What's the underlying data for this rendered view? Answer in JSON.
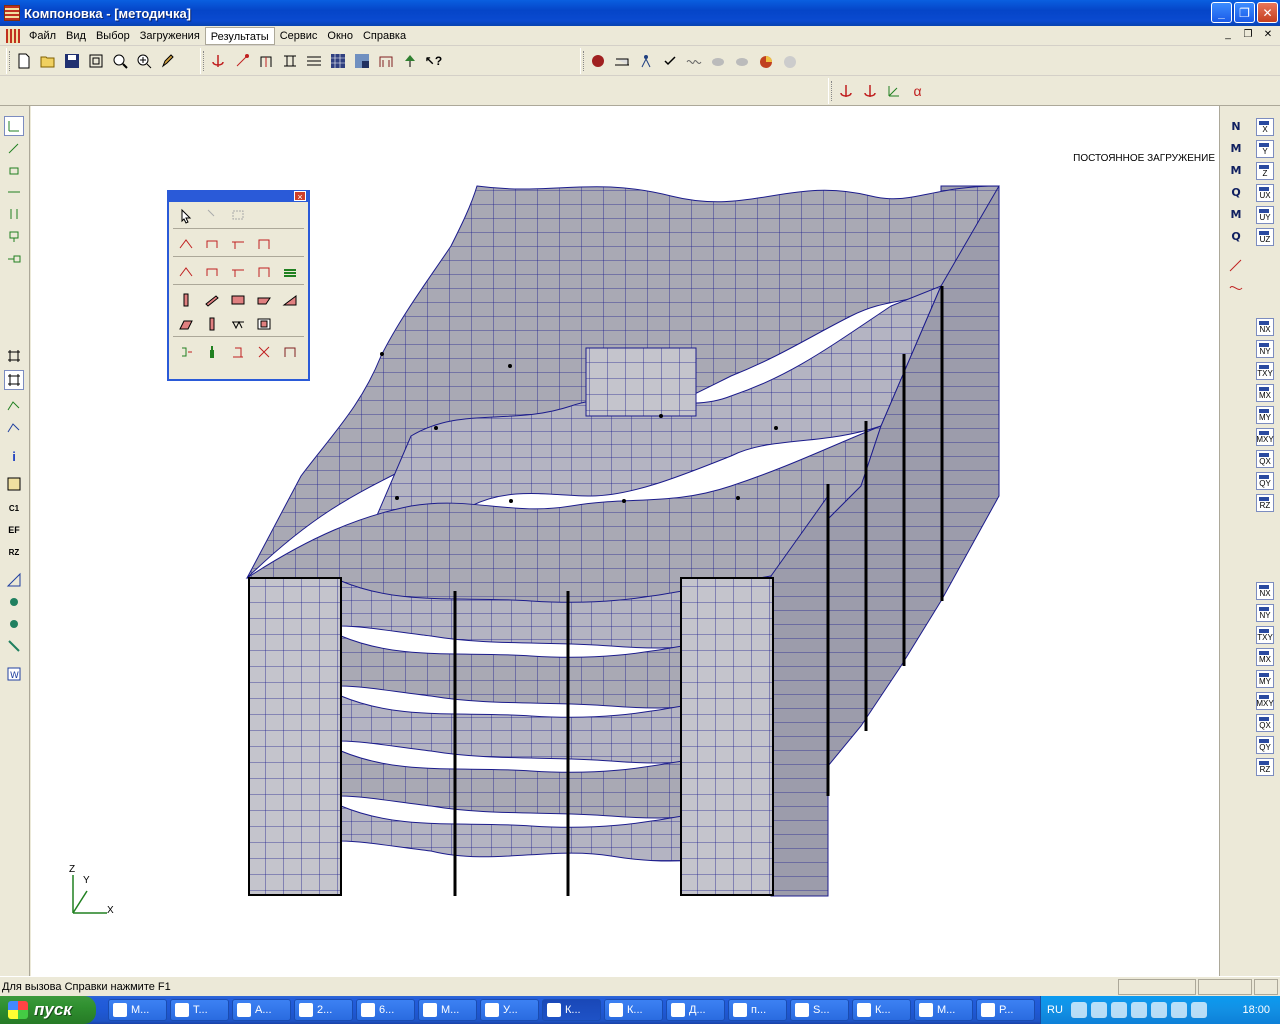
{
  "window": {
    "title": "Компоновка - [методичка]"
  },
  "menu": {
    "items": [
      "Файл",
      "Вид",
      "Выбор",
      "Загружения",
      "Результаты",
      "Сервис",
      "Окно",
      "Справка"
    ],
    "active_index": 4
  },
  "canvas": {
    "load_case": "ПОСТОЯННОЕ ЗАГРУЖЕНИЕ",
    "axis_z": "Z",
    "axis_y": "Y",
    "axis_x": "X"
  },
  "right_toolbar": {
    "col1": [
      "N",
      "M",
      "M",
      "Q",
      "M",
      "Q"
    ],
    "col2_top": [
      "X",
      "Y",
      "Z",
      "UX",
      "UY",
      "UZ"
    ],
    "col2_mid": [
      "NX",
      "NY",
      "TXY",
      "MX",
      "MY",
      "MXY",
      "QX",
      "QY",
      "RZ"
    ],
    "col2_bot": [
      "NX",
      "NY",
      "TXY",
      "MX",
      "MY",
      "MXY",
      "QX",
      "QY",
      "RZ"
    ]
  },
  "left_toolbar": {
    "labels": [
      "i",
      "C1",
      "EF",
      "RZ"
    ]
  },
  "toolbar2": {
    "alpha": "α"
  },
  "palette": {
    "close": "×"
  },
  "statusbar": {
    "hint": "Для вызова Справки нажмите F1"
  },
  "taskbar": {
    "start": "пуск",
    "tasks": [
      "M...",
      "T...",
      "A...",
      "2...",
      "6...",
      "M...",
      "У...",
      "К...",
      "К...",
      "Д...",
      "п...",
      "S...",
      "К...",
      "М...",
      "Р..."
    ],
    "active_task_index": 7,
    "lang": "RU",
    "clock": "18:00"
  },
  "colors": {
    "mesh_fill": "#a9a9b4",
    "mesh_line": "#1c1c8c",
    "title_blue": "#0545c8",
    "start_green": "#2f8f2f"
  }
}
